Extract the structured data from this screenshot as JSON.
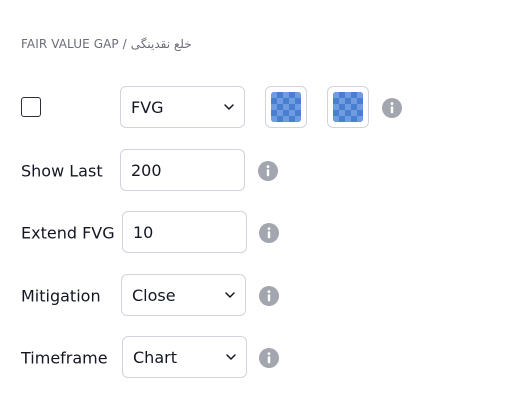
{
  "section": {
    "title": "FAIR VALUE GAP / خلع نقدینگی"
  },
  "rows": {
    "fvg": {
      "checked": false,
      "select_value": "FVG",
      "color1_icon": "checkerboard-swatch-icon",
      "color2_icon": "checkerboard-swatch-icon",
      "info_icon": "info-icon"
    },
    "show_last": {
      "label": "Show Last",
      "value": "200"
    },
    "extend_fvg": {
      "label": "Extend FVG",
      "value": "10"
    },
    "mitigation": {
      "label": "Mitigation",
      "value": "Close"
    },
    "timeframe": {
      "label": "Timeframe",
      "value": "Chart"
    }
  },
  "colors": {
    "swatch_blue": "#4a7fd0",
    "swatch_blue_light": "#6f9ce0",
    "info_gray": "#a3a6af",
    "border": "#d1d4dc"
  }
}
